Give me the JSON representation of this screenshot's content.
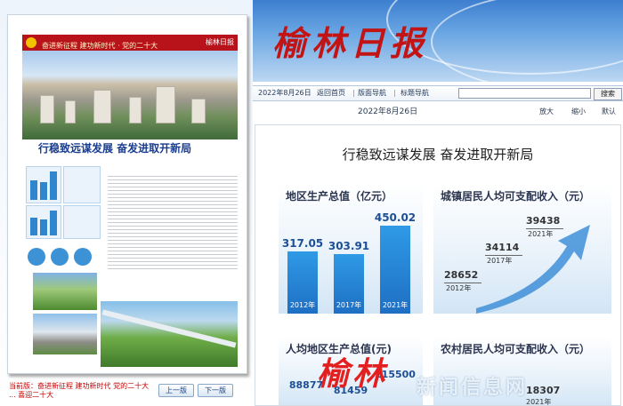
{
  "left": {
    "banner_text": "奋进新征程 建功新时代 · 党的二十大",
    "banner_mast": "榆林日报",
    "page_headline": "行稳致远谋发展 奋发进取开新局",
    "status_text": "当前版：奋进新征程 建功新时代 党的二十大 ... 喜迎二十大",
    "prev_label": "上一版",
    "next_label": "下一版"
  },
  "header": {
    "logo": "榆林日报"
  },
  "toolbar": {
    "date": "2022年8月26日",
    "home": "返回首页",
    "nav": "版面导航",
    "list": "标题导航",
    "search_button": "搜索"
  },
  "date_bar": {
    "date": "2022年8月26日",
    "zoom_in": "放大",
    "zoom_out": "缩小",
    "default": "默认"
  },
  "article": {
    "headline": "行稳致远谋发展  奋发进取开新局",
    "gdp_title": "地区生产总值（亿元）",
    "income_title": "城镇居民人均可支配收入（元）",
    "percap_title": "人均地区生产总值(元)",
    "rural_title": "农村居民人均可支配收入（元）",
    "percap_values": [
      "88877",
      "81459",
      "115500"
    ],
    "rural_value": "18307",
    "rural_year": "2021年"
  },
  "chart_data": [
    {
      "type": "bar",
      "title": "地区生产总值（亿元）",
      "categories": [
        "2012年",
        "2017年",
        "2021年"
      ],
      "values": [
        317.05,
        303.91,
        450.02
      ],
      "ylim": [
        0,
        500
      ]
    },
    {
      "type": "line",
      "title": "城镇居民人均可支配收入（元）",
      "x": [
        "2012年",
        "2017年",
        "2021年"
      ],
      "values": [
        28652,
        34114,
        39438
      ]
    }
  ],
  "watermark": {
    "left": "榆林",
    "right": "新闻信息网"
  },
  "colors": {
    "brand_red": "#c21414",
    "header_blue": "#3d7fcf",
    "bar_blue": "#1e6fc4"
  }
}
